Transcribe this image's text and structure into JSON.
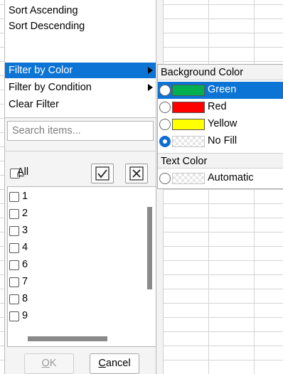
{
  "menu": {
    "items": [
      {
        "label": "Sort Ascending"
      },
      {
        "label": "Sort Descending"
      },
      {
        "label": "Filter by Color",
        "has_submenu": true,
        "selected": true
      },
      {
        "label": "Filter by Condition",
        "has_submenu": true
      },
      {
        "label": "Clear Filter"
      }
    ]
  },
  "search": {
    "placeholder": "Search items..."
  },
  "all": {
    "prefix": "",
    "underlined": "A",
    "suffix": "ll"
  },
  "toolbar": {
    "check_all_icon": "check-icon",
    "uncheck_all_icon": "x-icon"
  },
  "list": {
    "items": [
      "1",
      "2",
      "3",
      "4",
      "6",
      "7",
      "8",
      "9"
    ]
  },
  "buttons": {
    "ok_u": "O",
    "ok_rest": "K",
    "cancel_u": "C",
    "cancel_rest": "ancel"
  },
  "submenu": {
    "background_header": "Background Color",
    "background_items": [
      {
        "label": "Green",
        "color": "#00b050",
        "selected": true,
        "checked": false
      },
      {
        "label": "Red",
        "color": "#ff0000",
        "selected": false,
        "checked": false
      },
      {
        "label": "Yellow",
        "color": "#ffff00",
        "selected": false,
        "checked": false
      },
      {
        "label": "No Fill",
        "color": "none",
        "selected": false,
        "checked": true
      }
    ],
    "text_header": "Text Color",
    "text_items": [
      {
        "label": "Automatic",
        "color": "none",
        "checked": false
      }
    ]
  },
  "colors": {
    "accent": "#0c74d4"
  }
}
